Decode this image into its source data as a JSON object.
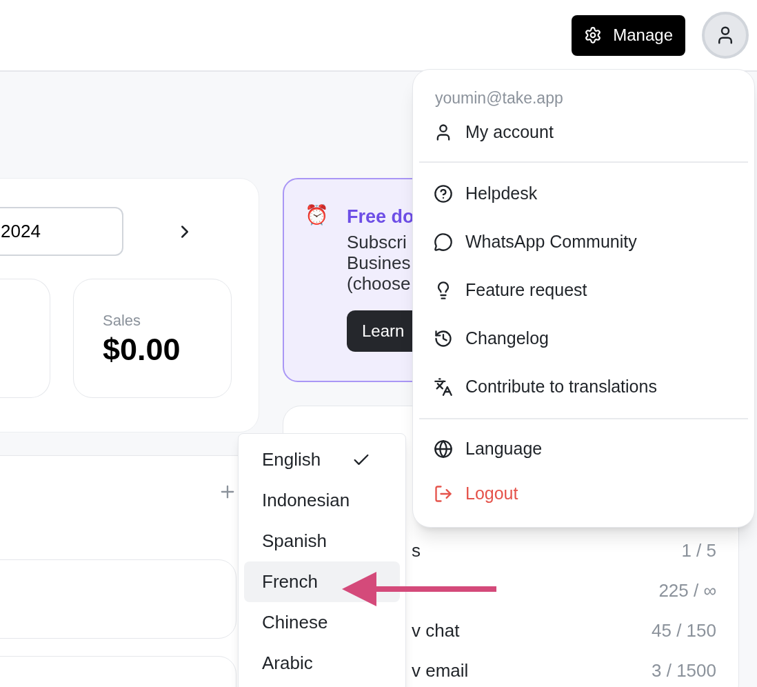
{
  "header": {
    "manage_button": "Manage"
  },
  "overview": {
    "date_field": "2024",
    "stats": [
      {
        "label": "Sales",
        "value": "$0.00"
      }
    ]
  },
  "promo": {
    "icon": "⏰",
    "title": "Free do",
    "body": [
      "Subscri",
      "Busines",
      "(choose"
    ],
    "button": "Learn"
  },
  "usage": {
    "rows": [
      {
        "label": "s",
        "value": "1 / 5"
      },
      {
        "value": "225 / ∞"
      },
      {
        "label": "v chat",
        "value": "45 / 150"
      },
      {
        "label": "v email",
        "value": "3 / 1500"
      }
    ]
  },
  "account_menu": {
    "email": "youmin@take.app",
    "groups": [
      [
        {
          "label": "My account",
          "kind": "item"
        }
      ],
      [
        {
          "label": "Helpdesk",
          "kind": "item"
        },
        {
          "label": "WhatsApp Community",
          "kind": "item"
        },
        {
          "label": "Feature request",
          "kind": "item"
        },
        {
          "label": "Changelog",
          "kind": "item"
        },
        {
          "label": "Contribute to translations",
          "kind": "item"
        }
      ],
      [
        {
          "label": "Language",
          "kind": "item"
        },
        {
          "label": "Logout",
          "kind": "danger"
        }
      ]
    ]
  },
  "language_menu": {
    "items": [
      {
        "label": "English",
        "checked": true,
        "highlighted": false
      },
      {
        "label": "Indonesian",
        "checked": false,
        "highlighted": false
      },
      {
        "label": "Spanish",
        "checked": false,
        "highlighted": false
      },
      {
        "label": "French",
        "checked": false,
        "highlighted": true
      },
      {
        "label": "Chinese",
        "checked": false,
        "highlighted": false
      },
      {
        "label": "Arabic",
        "checked": false,
        "highlighted": false
      }
    ]
  }
}
